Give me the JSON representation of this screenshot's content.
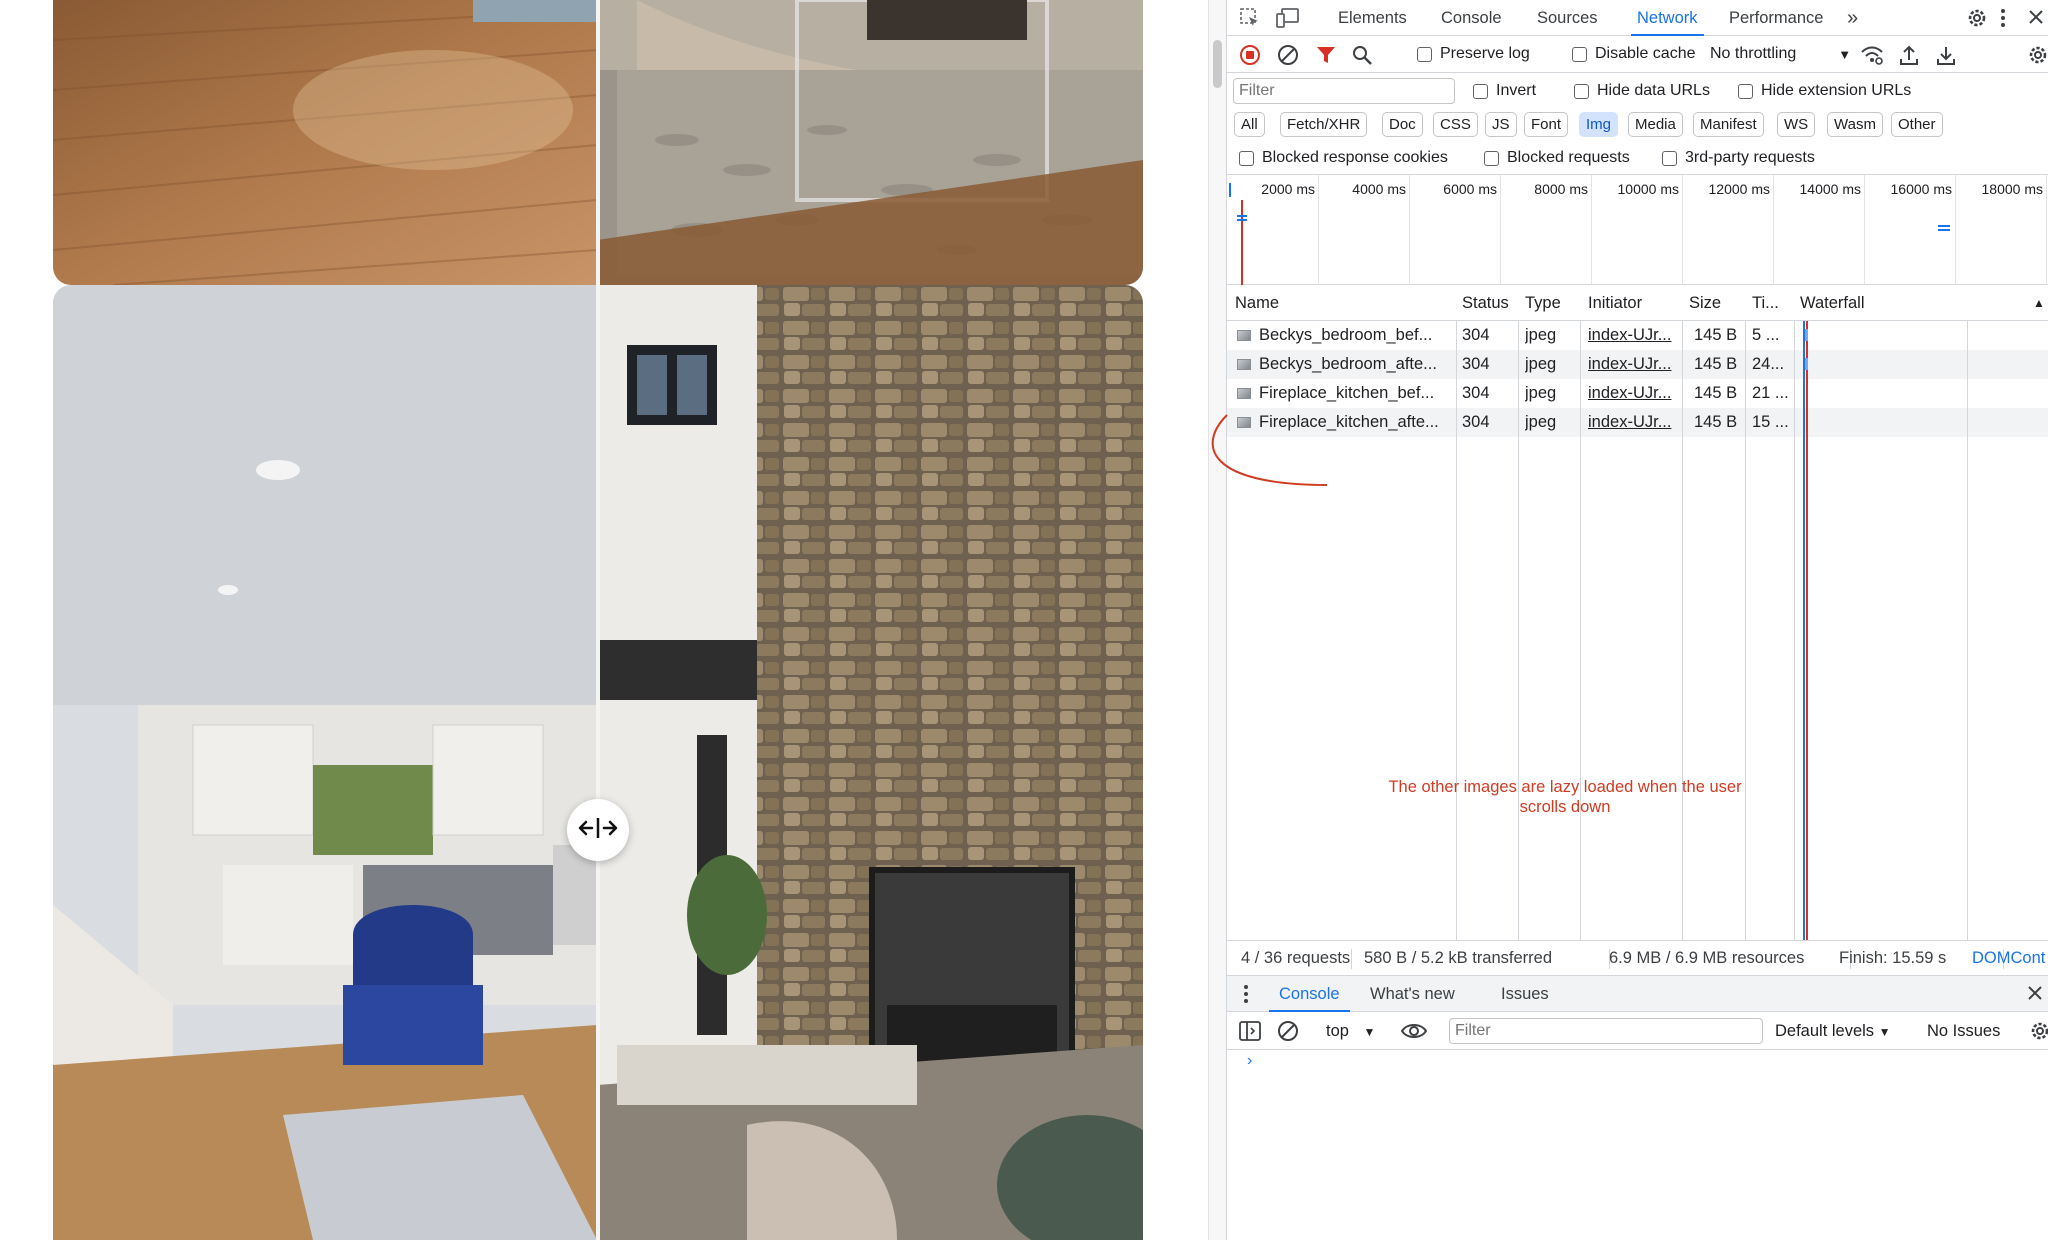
{
  "page": {
    "comparisons": [
      {
        "name": "Beckys bedroom",
        "before_desc": "hardwood floor",
        "after_desc": "rug and glass table"
      },
      {
        "name": "Fireplace kitchen",
        "before_desc": "kitchen with blue chair",
        "after_desc": "stone fireplace living room"
      }
    ],
    "handle_icon": "arrows-left-right-icon"
  },
  "devtools": {
    "tabs": [
      "Elements",
      "Console",
      "Sources",
      "Network",
      "Performance"
    ],
    "active_tab": "Network",
    "more_tabs": "»",
    "toolbar": {
      "preserve_log": "Preserve log",
      "disable_cache": "Disable cache",
      "throttling": "No throttling"
    },
    "filter": {
      "placeholder": "Filter",
      "invert": "Invert",
      "hide_data_urls": "Hide data URLs",
      "hide_extension_urls": "Hide extension URLs"
    },
    "type_filters": [
      "All",
      "Fetch/XHR",
      "Doc",
      "CSS",
      "JS",
      "Font",
      "Img",
      "Media",
      "Manifest",
      "WS",
      "Wasm",
      "Other"
    ],
    "active_type": "Img",
    "block_filters": {
      "blocked_cookies": "Blocked response cookies",
      "blocked_requests": "Blocked requests",
      "third_party": "3rd-party requests"
    },
    "overview_ticks": [
      "2000 ms",
      "4000 ms",
      "6000 ms",
      "8000 ms",
      "10000 ms",
      "12000 ms",
      "14000 ms",
      "16000 ms",
      "18000 ms"
    ],
    "columns": {
      "name": "Name",
      "status": "Status",
      "type": "Type",
      "initiator": "Initiator",
      "size": "Size",
      "time": "Ti...",
      "waterfall": "Waterfall"
    },
    "rows": [
      {
        "name": "Beckys_bedroom_bef...",
        "status": "304",
        "type": "jpeg",
        "initiator": "index-UJr...",
        "size": "145 B",
        "time": "5 ..."
      },
      {
        "name": "Beckys_bedroom_afte...",
        "status": "304",
        "type": "jpeg",
        "initiator": "index-UJr...",
        "size": "145 B",
        "time": "24..."
      },
      {
        "name": "Fireplace_kitchen_bef...",
        "status": "304",
        "type": "jpeg",
        "initiator": "index-UJr...",
        "size": "145 B",
        "time": "21 ..."
      },
      {
        "name": "Fireplace_kitchen_afte...",
        "status": "304",
        "type": "jpeg",
        "initiator": "index-UJr...",
        "size": "145 B",
        "time": "15 ..."
      }
    ],
    "annotation": "The other images are lazy loaded when the user scrolls down",
    "summary": {
      "requests": "4 / 36 requests",
      "transferred": "580 B / 5.2 kB transferred",
      "resources": "6.9 MB / 6.9 MB resources",
      "finish": "Finish: 15.59 s",
      "domcontent": "DOMCont"
    },
    "drawer": {
      "tabs": [
        "Console",
        "What's new",
        "Issues"
      ],
      "active": "Console"
    },
    "console": {
      "context": "top",
      "filter_placeholder": "Filter",
      "levels": "Default levels",
      "issues": "No Issues",
      "prompt": "›"
    },
    "colors": {
      "accent": "#1a73e8",
      "annotation": "#d03b22",
      "record": "#d93025"
    }
  }
}
